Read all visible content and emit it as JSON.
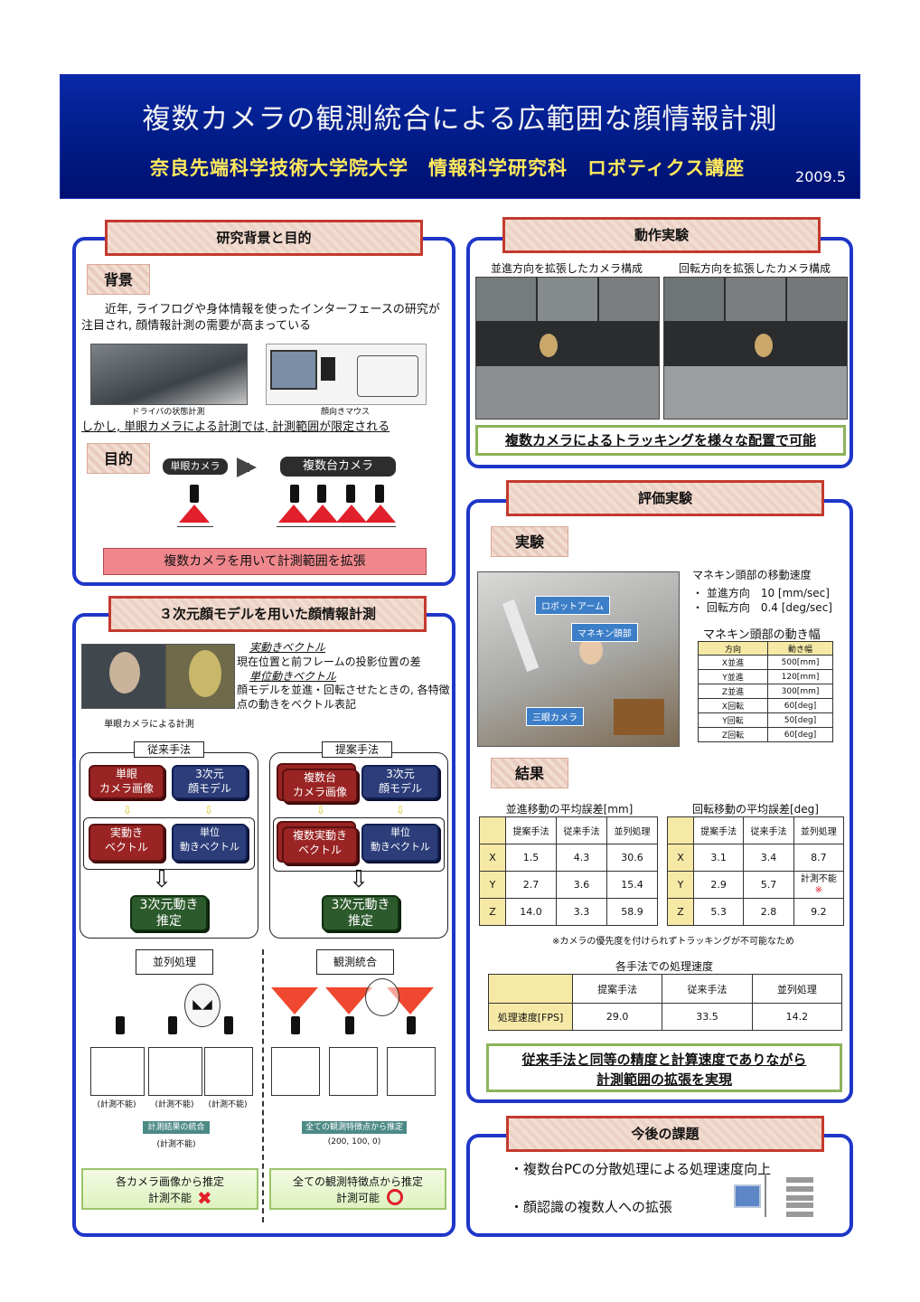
{
  "header": {
    "title": "複数カメラの観測統合による広範囲な顔情報計測",
    "affiliation": "奈良先端科学技術大学院大学　情報科学研究科　ロボティクス講座",
    "date": "2009.5"
  },
  "background_section": {
    "heading": "研究背景と目的",
    "bg_label": "背景",
    "bg_text": "近年, ライフログや身体情報を使ったインターフェースの研究が注目され, 顔情報計測の需要が高まっている",
    "img1_caption": "ドライバの状態計測",
    "img2_caption": "顔向きマウス",
    "limitation": "しかし, 単眼カメラによる計測では, 計測範囲が限定される",
    "purpose_label": "目的",
    "single_cam": "単眼カメラ",
    "multi_cam": "複数台カメラ",
    "purpose_text": "複数カメラを用いて計測範囲を拡張"
  },
  "model_section": {
    "heading": "３次元顔モデルを用いた顔情報計測",
    "real_vec_title": "実動きベクトル",
    "real_vec_text": "現在位置と前フレームの投影位置の差",
    "unit_vec_title": "単位動きベクトル",
    "unit_vec_text": "顔モデルを並進・回転させたときの, 各特徴点の動きをベクトル表記",
    "photo_caption": "単眼カメラによる計測",
    "conventional": "従来手法",
    "proposed": "提案手法",
    "conv_a": "単眼\nカメラ画像",
    "conv_b": "3次元\n顔モデル",
    "conv_c": "実動き\nベクトル",
    "conv_d": "単位\n動きベクトル",
    "conv_e": "3次元動き\n推定",
    "prop_a": "複数台\nカメラ画像",
    "prop_b": "3次元\n顔モデル",
    "prop_c": "複数実動き\nベクトル",
    "prop_d": "単位\n動きベクトル",
    "prop_e": "3次元動き\n推定",
    "parallel": "並列処理",
    "integration": "観測統合",
    "na": "(計測不能)",
    "merge_label": "計測結果の統合",
    "all_points_label": "全ての観測特徴点から推定",
    "coords": "(200, 100, 0)",
    "left_result": "各カメラ画像から推定\n計測不能",
    "right_result": "全ての観測特徴点から推定\n計測可能"
  },
  "motion_section": {
    "heading": "動作実験",
    "cap_left": "並進方向を拡張したカメラ構成",
    "cap_right": "回転方向を拡張したカメラ構成",
    "result": "複数カメラによるトラッキングを様々な配置で可能"
  },
  "eval_section": {
    "heading": "評価実験",
    "exp_label": "実験",
    "tag_arm": "ロボットアーム",
    "tag_head": "マネキン頭部",
    "tag_cam": "三眼カメラ",
    "speed_title": "マネキン頭部の移動速度",
    "speed_1": "・ 並進方向　10 [mm/sec]",
    "speed_2": "・ 回転方向　0.4 [deg/sec]",
    "move_title": "マネキン頭部の動き幅",
    "move_cols": [
      "方向",
      "動き幅"
    ],
    "move_rows": [
      [
        "X並進",
        "500[mm]"
      ],
      [
        "Y並進",
        "120[mm]"
      ],
      [
        "Z並進",
        "300[mm]"
      ],
      [
        "X回転",
        "60[deg]"
      ],
      [
        "Y回転",
        "50[deg]"
      ],
      [
        "Z回転",
        "60[deg]"
      ]
    ],
    "result_label": "結果",
    "trans_title": "並進移動の平均誤差[mm]",
    "rot_title": "回転移動の平均誤差[deg]",
    "err_cols": [
      "提案手法",
      "従来手法",
      "並列処理"
    ],
    "trans_rows": [
      [
        "X",
        "1.5",
        "4.3",
        "30.6"
      ],
      [
        "Y",
        "2.7",
        "3.6",
        "15.4"
      ],
      [
        "Z",
        "14.0",
        "3.3",
        "58.9"
      ]
    ],
    "rot_rows": [
      [
        "X",
        "3.1",
        "3.4",
        "8.7"
      ],
      [
        "Y",
        "2.9",
        "5.7",
        "計測不能"
      ],
      [
        "Z",
        "5.3",
        "2.8",
        "9.2"
      ]
    ],
    "mark": "※",
    "footnote": "※カメラの優先度を付けられずトラッキングが不可能なため",
    "fps_title": "各手法での処理速度",
    "fps_cols": [
      "提案手法",
      "従来手法",
      "並列処理"
    ],
    "fps_row_label": "処理速度[FPS]",
    "fps_values": [
      "29.0",
      "33.5",
      "14.2"
    ],
    "conclusion": "従来手法と同等の精度と計算速度でありながら\n計測範囲の拡張を実現"
  },
  "future_section": {
    "heading": "今後の課題",
    "item1": "・複数台PCの分散処理による処理速度向上",
    "item2": "・顔認識の複数人への拡張"
  },
  "colors": {
    "banner": "#001b86",
    "panel_border": "#1f36c8",
    "heading_border": "#c43a2e",
    "affiliation": "#ffe95c"
  }
}
